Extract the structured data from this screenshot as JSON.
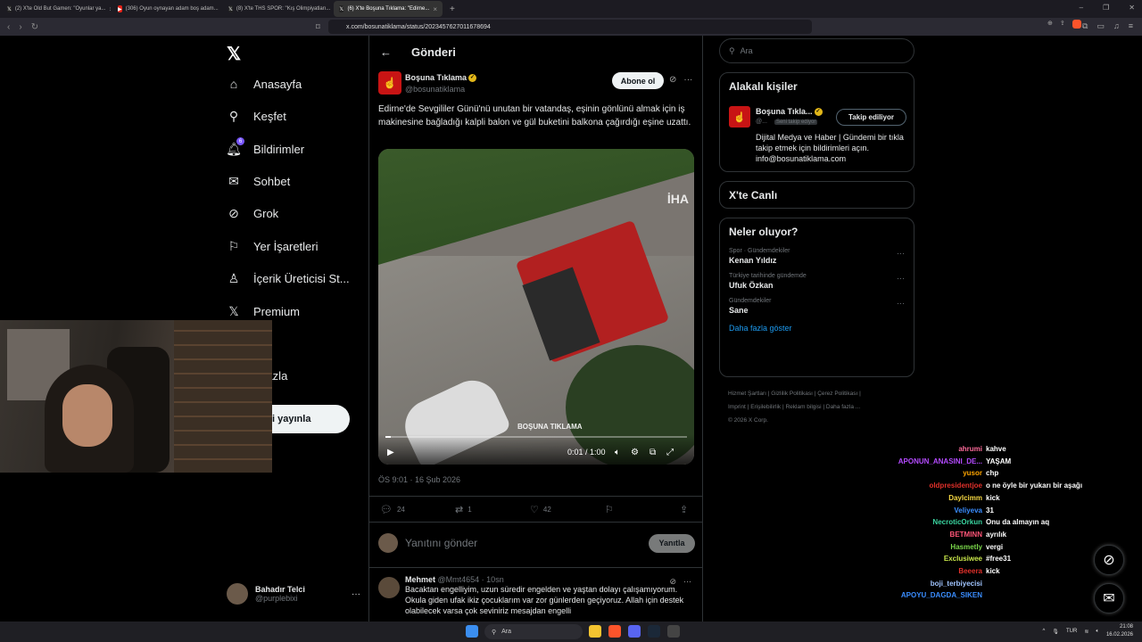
{
  "browser": {
    "tabs": [
      {
        "label": "(2) X'te Old But Gamen: \"Oyunlar ya...",
        "icon": "x-favicon",
        "active": false
      },
      {
        "label": "(306) Oyun oynayan adam boş adam...",
        "icon": "youtube-favicon",
        "active": false
      },
      {
        "label": "(8) X'te THS SPOR: \"Kış Olimpiyatları...",
        "icon": "x-favicon",
        "active": false
      },
      {
        "label": "(6) X'te Boşuna Tıklama: \"Edirne...",
        "icon": "x-favicon",
        "active": true
      }
    ],
    "url": "x.com/bosunatiklama/status/2023457627011678694"
  },
  "nav": {
    "items": [
      {
        "label": "Anasayfa",
        "icon": "home-icon"
      },
      {
        "label": "Keşfet",
        "icon": "search-icon"
      },
      {
        "label": "Bildirimler",
        "icon": "bell-icon",
        "badge": "6"
      },
      {
        "label": "Sohbet",
        "icon": "mail-icon"
      },
      {
        "label": "Grok",
        "icon": "grok-icon"
      },
      {
        "label": "Yer İşaretleri",
        "icon": "bookmark-icon"
      },
      {
        "label": "İçerik Üreticisi St...",
        "icon": "creator-studio-icon"
      },
      {
        "label": "Premium",
        "icon": "x-premium-icon"
      },
      {
        "label": "fil",
        "icon": "profile-icon"
      },
      {
        "label": "a fazla",
        "icon": "more-icon"
      }
    ],
    "post_button": "leri yayınla",
    "profile": {
      "name": "Bahadır Telci",
      "handle": "@purplebixi"
    }
  },
  "main": {
    "title": "Gönderi",
    "tweet": {
      "author": "Boşuna Tıklama",
      "handle": "@bosunatiklama",
      "follow_label": "Abone ol",
      "text": "Edirne'de Sevgililer Günü'nü unutan bir vatandaş, eşinin gönlünü almak için iş makinesine bağladığı kalpli balon ve gül buketini balkona çağırdığı eşine uzattı.",
      "media": {
        "watermark_top": "İHA",
        "watermark_bottom": "BOŞUNA TIKLAMA",
        "time": "0:01 / 1:00",
        "progress": 0.017
      },
      "date": "ÖS 9:01 · 16 Şub 2026",
      "replies": "24",
      "reposts": "1",
      "likes": "42"
    },
    "reply": {
      "placeholder": "Yanıtını gönder",
      "button": "Yanıtla"
    },
    "comment": {
      "author": "Mehmet",
      "meta": "@Mmt4654 · 10sn",
      "text": "Bacaktan engelliyim, uzun süredir engelden ve yaştan dolayı çalışamıyorum. Okula giden ufak ikiz çocuklarım var zor günlerden geçiyoruz. Allah için destek olabilecek varsa çok seviniriz mesajdan engelli"
    }
  },
  "sidebar": {
    "search_placeholder": "Ara",
    "related": {
      "title": "Alakalı kişiler",
      "name": "Boşuna Tıkla...",
      "handle": "@...",
      "follows_you": "Seni takip ediyor",
      "button": "Takip ediliyor",
      "bio": "Dijital Medya ve Haber | Gündemi bir tıkla takip etmek için bildirimleri açın. info@bosunatiklama.com"
    },
    "live_title": "X'te Canlı",
    "trends_title": "Neler oluyor?",
    "trends": [
      {
        "category": "Spor · Gündemdekiler",
        "topic": "Kenan Yıldız"
      },
      {
        "category": "Türkiye tarihinde gündemde",
        "topic": "Ufuk Özkan"
      },
      {
        "category": "Gündemdekiler",
        "topic": "Sane"
      }
    ],
    "show_more": "Daha fazla göster",
    "footer": [
      "Hizmet Şartları",
      "Gizlilik Politikası",
      "Çerez Politikası",
      "Imprint",
      "Erişilebilirlik",
      "Reklam bilgisi",
      "Daha fazla ...",
      "© 2026 X Corp."
    ]
  },
  "chat": [
    {
      "user": "ahrumi",
      "msg": "kahve",
      "color": "#ff6b9b"
    },
    {
      "user": "APONUN_ANASINI_DE...",
      "msg": "YAŞAM",
      "color": "#b44bff"
    },
    {
      "user": "yusor",
      "msg": "chp",
      "color": "#ffa500"
    },
    {
      "user": "oldpresidentjoe",
      "msg": "o ne öyle bir yukarı bir aşağı",
      "color": "#e0302a"
    },
    {
      "user": "Daylcimm",
      "msg": "kick",
      "color": "#f5d742"
    },
    {
      "user": "Veliyeva",
      "msg": "31",
      "color": "#3a8dff"
    },
    {
      "user": "NecroticOrkun",
      "msg": "Onu da almayın aq",
      "color": "#3ad4a0"
    },
    {
      "user": "BETMINN",
      "msg": "ayrılık",
      "color": "#ff5577"
    },
    {
      "user": "Hasmetly",
      "msg": "vergi",
      "color": "#7ad64a"
    },
    {
      "user": "Exclusiwee",
      "msg": "#free31",
      "color": "#c8e64a"
    },
    {
      "user": "Beeera",
      "msg": "kick",
      "color": "#e0302a"
    },
    {
      "user": "boji_terbiyecisi",
      "msg": "",
      "color": "#a0c4ff"
    },
    {
      "user": "APOYU_DAGDA_SIKEN",
      "msg": "",
      "color": "#3a8dff"
    }
  ],
  "taskbar": {
    "search": "Ara",
    "lang": "TUR",
    "time": "21:08",
    "date": "16.02.2026"
  }
}
